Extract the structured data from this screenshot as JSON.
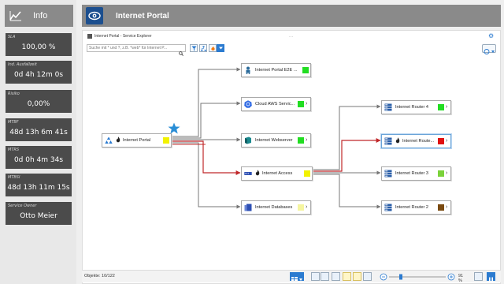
{
  "info": {
    "title": "Info"
  },
  "kpis": [
    {
      "label": "SLA",
      "value": "100,00 %"
    },
    {
      "label": "Ind. Ausfallzeit",
      "value": "0d 4h 12m 0s"
    },
    {
      "label": "Risiko",
      "value": "0,00%"
    },
    {
      "label": "MTBF",
      "value": "48d 13h 6m 41s"
    },
    {
      "label": "MTRS",
      "value": "0d 0h 4m 34s"
    },
    {
      "label": "MTBSI",
      "value": "48d 13h 11m 15s"
    },
    {
      "label": "Service Owner",
      "value": "Otto Meier"
    }
  ],
  "header": {
    "title": "Internet Portal"
  },
  "explorer": {
    "breadcrumb": "Internet Portal - Service Explorer",
    "search_placeholder": "Suche mit * und ?, z.B. *web* für Internet P..."
  },
  "nodes": {
    "portal": {
      "label": "Internet Portal",
      "status_color": "#f2f200"
    },
    "e2e": {
      "label": "Internet Portal E2E ...",
      "status_color": "#22dd22"
    },
    "aws": {
      "label": "Cloud AWS Servic...",
      "status_color": "#22dd22"
    },
    "webserver": {
      "label": "Internet Webserver",
      "status_color": "#22dd22"
    },
    "access": {
      "label": "Internet Access",
      "status_color": "#f2f200"
    },
    "databases": {
      "label": "Internet Databases",
      "status_color": "#f5f5a0"
    },
    "router4": {
      "label": "Internet Router 4",
      "status_color": "#22dd22"
    },
    "router1": {
      "label": "Internet Route...",
      "status_color": "#e01010"
    },
    "router3": {
      "label": "Internet Router 3",
      "status_color": "#7bd23a"
    },
    "router2": {
      "label": "Internet Router 2",
      "status_color": "#7a4a10"
    }
  },
  "footer": {
    "count": "Objekte: 10/122",
    "zoom": "91 %"
  },
  "colors": {
    "accent": "#2b7bd0",
    "panel_dark": "#4b4b4b",
    "header_grey": "#8a8a8a",
    "edge_red": "#c0282a",
    "edge_grey": "#777777"
  }
}
